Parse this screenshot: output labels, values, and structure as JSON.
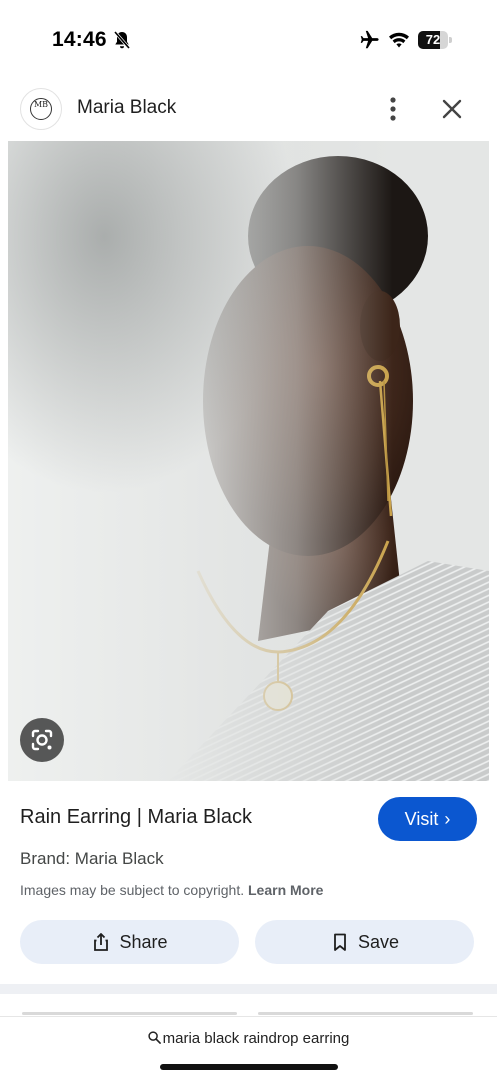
{
  "status_bar": {
    "time": "14:46",
    "battery_level": "72",
    "battery_fraction": 0.72,
    "icons": [
      "bell-slash-icon",
      "airplane-icon",
      "wifi-icon",
      "battery-icon"
    ]
  },
  "header": {
    "site_name": "Maria Black",
    "logo_text": "MB",
    "icons": [
      "more-vert-icon",
      "close-icon"
    ]
  },
  "image": {
    "icon": "google-lens-icon"
  },
  "result": {
    "title": "Rain Earring | Maria Black",
    "visit_label": "Visit",
    "brand": "Brand: Maria Black",
    "copyright_text": "Images may be subject to copyright.",
    "learn_more": "Learn More",
    "share_label": "Share",
    "save_label": "Save"
  },
  "browser": {
    "search_query": "maria black raindrop earring"
  },
  "colors": {
    "accent": "#0b57d0",
    "action_button_bg": "#e8eef8",
    "text_primary": "#1f1f1f",
    "text_secondary": "#5f6368"
  }
}
